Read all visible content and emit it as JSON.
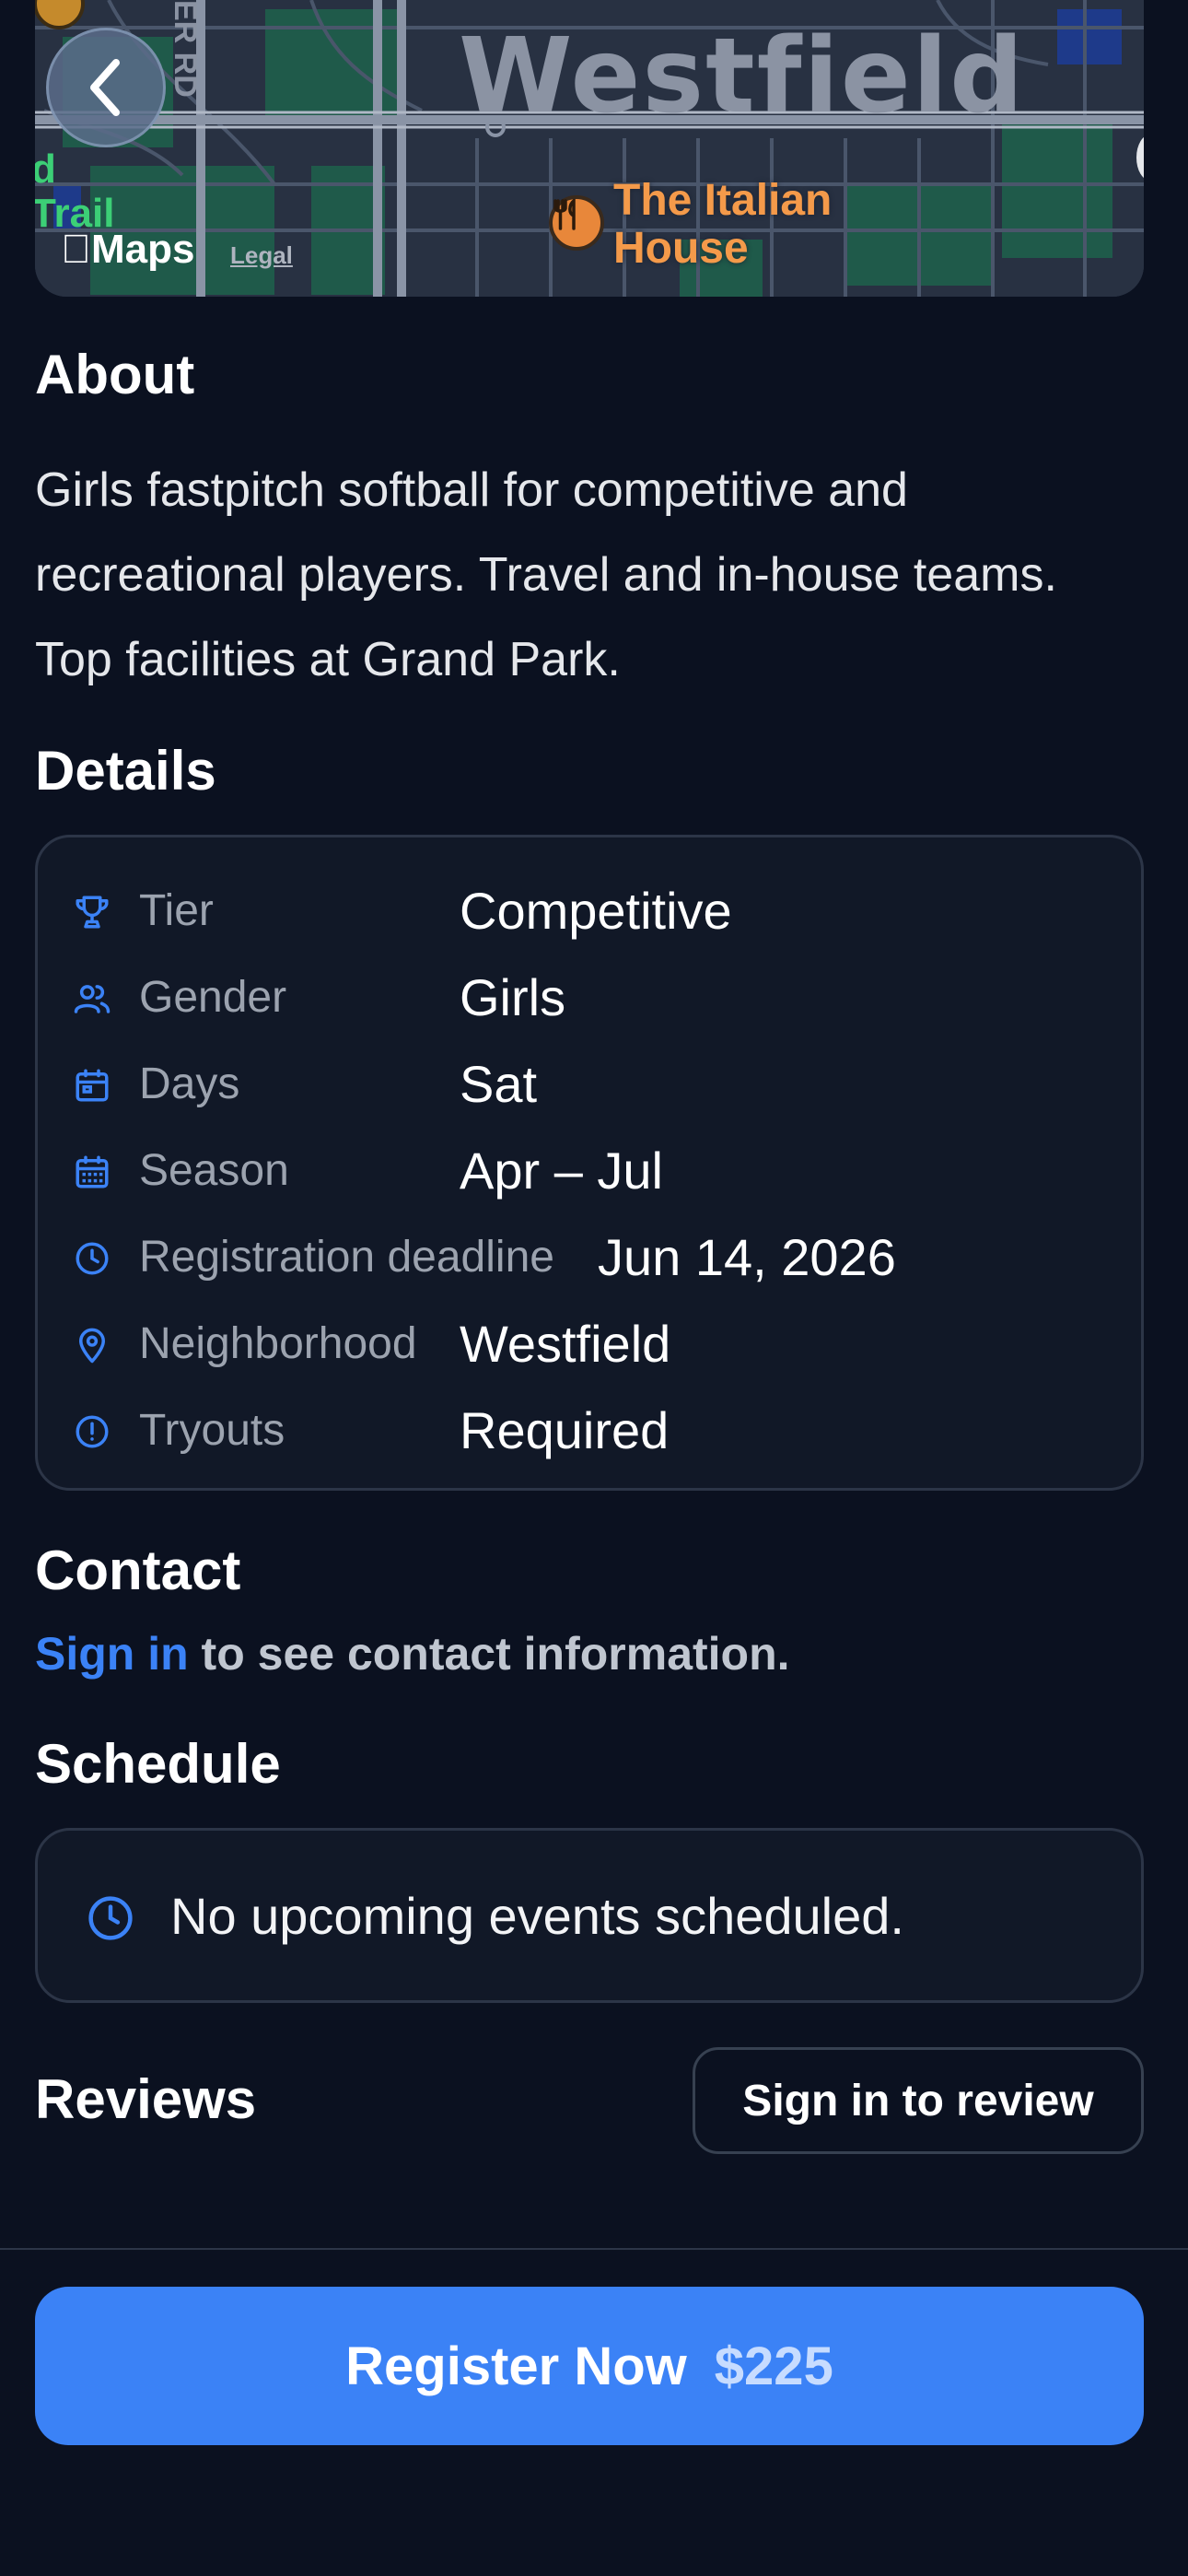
{
  "map": {
    "city_label": "Westfield",
    "road_label": "ER RD",
    "trail_label": "d\nTrail",
    "poi_label": "The Italian\nHouse",
    "poi_icon": "fork-knife-icon",
    "provider_label": "Maps",
    "legal_label": "Legal"
  },
  "back_button": {
    "icon": "chevron-left-icon"
  },
  "about": {
    "heading": "About",
    "text": "Girls fastpitch softball for competitive and recreational players. Travel and in-house teams. Top facilities at Grand Park."
  },
  "details": {
    "heading": "Details",
    "rows": [
      {
        "icon": "trophy-icon",
        "label": "Tier",
        "value": "Competitive"
      },
      {
        "icon": "users-icon",
        "label": "Gender",
        "value": "Girls"
      },
      {
        "icon": "calendar-icon",
        "label": "Days",
        "value": "Sat"
      },
      {
        "icon": "calendar-grid-icon",
        "label": "Season",
        "value": "Apr – Jul"
      },
      {
        "icon": "clock-icon",
        "label": "Registration deadline",
        "value": "Jun 14, 2026"
      },
      {
        "icon": "map-pin-icon",
        "label": "Neighborhood",
        "value": "Westfield"
      },
      {
        "icon": "alert-circle-icon",
        "label": "Tryouts",
        "value": "Required"
      }
    ]
  },
  "contact": {
    "heading": "Contact",
    "link_text": "Sign in",
    "rest_text": " to see contact information."
  },
  "schedule": {
    "heading": "Schedule",
    "empty_text": "No upcoming events scheduled."
  },
  "reviews": {
    "heading": "Reviews",
    "button_label": "Sign in to review"
  },
  "register": {
    "label": "Register Now",
    "price": "$225"
  },
  "colors": {
    "background": "#0b1120",
    "card": "#111827",
    "accent": "#3b82f6",
    "icon_blue": "#3b82f6"
  }
}
